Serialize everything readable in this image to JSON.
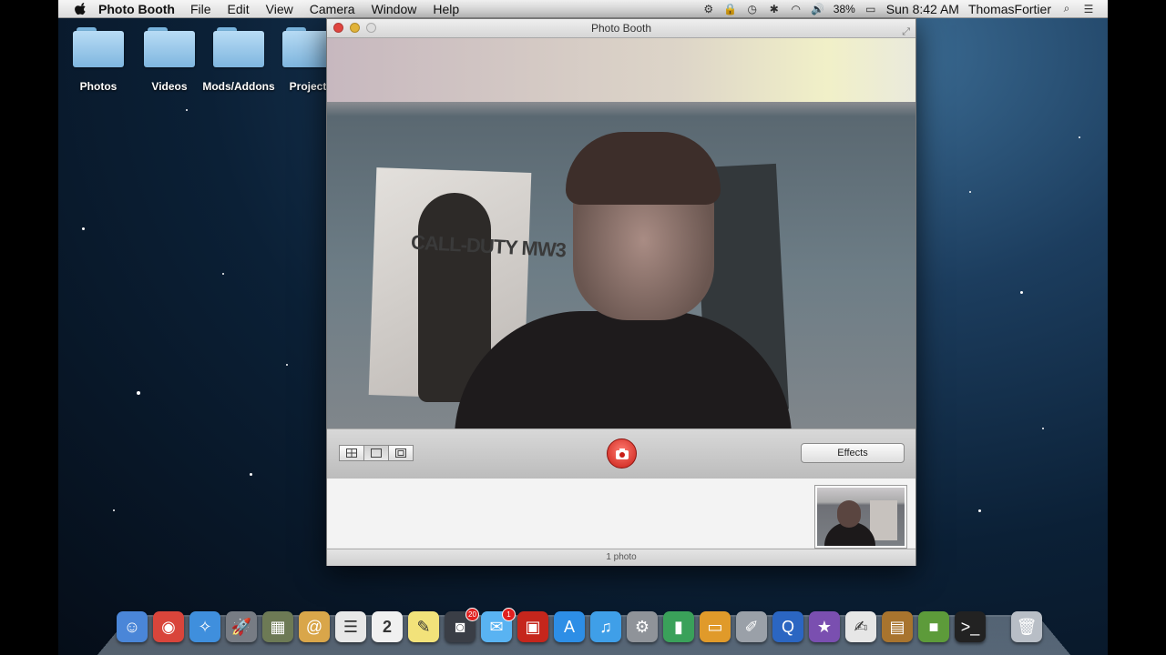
{
  "menubar": {
    "app_name": "Photo Booth",
    "menus": [
      "File",
      "Edit",
      "View",
      "Camera",
      "Window",
      "Help"
    ],
    "battery": "38%",
    "clock": "Sun 8:42 AM",
    "user": "ThomasFortier"
  },
  "desktop": {
    "icons": [
      {
        "label": "Photos"
      },
      {
        "label": "Videos"
      },
      {
        "label": "Mods/Addons"
      },
      {
        "label": "Project"
      }
    ]
  },
  "window": {
    "title": "Photo Booth",
    "toolbar": {
      "effects_label": "Effects"
    },
    "status": "1 photo",
    "poster_text": "CALL-DUTY MW3"
  },
  "dock": {
    "apps": [
      {
        "name": "finder-icon",
        "color": "#4a86d8"
      },
      {
        "name": "chrome-icon",
        "color": "#d9453b"
      },
      {
        "name": "safari-icon",
        "color": "#3f8fdd"
      },
      {
        "name": "launchpad-icon",
        "color": "#777c84"
      },
      {
        "name": "preview-icon",
        "color": "#6d7a55"
      },
      {
        "name": "mail-icon",
        "color": "#d9a64a"
      },
      {
        "name": "reminders-icon",
        "color": "#e8e8e8"
      },
      {
        "name": "calendar-icon",
        "color": "#f0f0f0"
      },
      {
        "name": "notes-icon",
        "color": "#f2e27a"
      },
      {
        "name": "facetime-icon",
        "color": "#3a3e46"
      },
      {
        "name": "messages-icon",
        "color": "#59b3f2"
      },
      {
        "name": "photobooth-icon",
        "color": "#c5261c"
      },
      {
        "name": "appstore-icon",
        "color": "#2d8ee6"
      },
      {
        "name": "itunes-icon",
        "color": "#3f9fe8"
      },
      {
        "name": "system-preferences-icon",
        "color": "#8f9399"
      },
      {
        "name": "numbers-icon",
        "color": "#3aa15a"
      },
      {
        "name": "keynote-icon",
        "color": "#e09a2a"
      },
      {
        "name": "script-editor-icon",
        "color": "#9aa0a8"
      },
      {
        "name": "quicktime-icon",
        "color": "#2b66c2"
      },
      {
        "name": "imovie-icon",
        "color": "#7a4fb0"
      },
      {
        "name": "textedit-icon",
        "color": "#e6e6e6"
      },
      {
        "name": "iphoto-icon",
        "color": "#a8742e"
      },
      {
        "name": "minecraft-icon",
        "color": "#5d9b3a"
      },
      {
        "name": "terminal-icon",
        "color": "#222222"
      },
      {
        "name": "trash-icon",
        "color": "#b8bec6"
      }
    ],
    "badges": {
      "facetime": "20",
      "messages": "1"
    },
    "calendar_day": "2"
  }
}
